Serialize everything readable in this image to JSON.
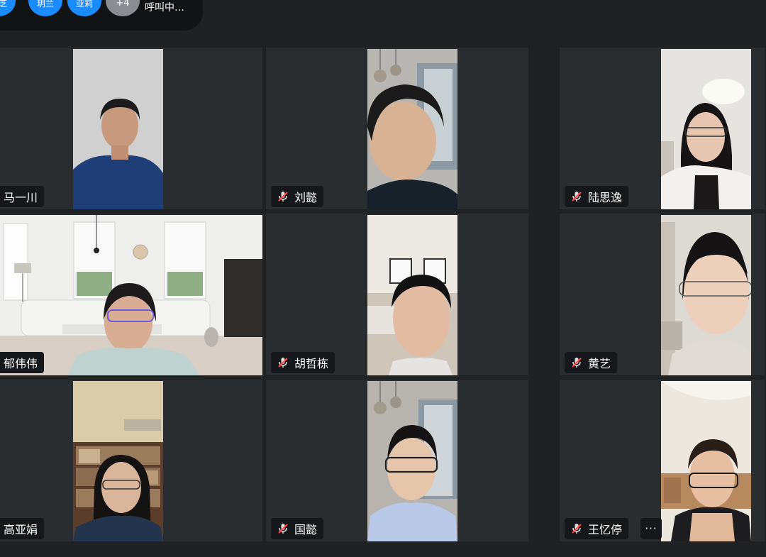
{
  "calling_bar": {
    "avatars": [
      "芳芝",
      "玥兰",
      "亚莉"
    ],
    "more_count": "+4",
    "status": "呼叫中…"
  },
  "participants": [
    {
      "name": "马一川",
      "muted": false
    },
    {
      "name": "刘懿",
      "muted": true
    },
    {
      "name": "陆思逸",
      "muted": true
    },
    {
      "name": "郁伟伟",
      "muted": false
    },
    {
      "name": "胡哲栋",
      "muted": true
    },
    {
      "name": "黄艺",
      "muted": true
    },
    {
      "name": "高亚娟",
      "muted": false
    },
    {
      "name": "国懿",
      "muted": true
    },
    {
      "name": "王忆停",
      "muted": true
    }
  ],
  "more_options": "···",
  "colors": {
    "accent": "#1a8cff",
    "muted_icon": "#ff4d4f",
    "tile_bg": "#2a2d2f"
  }
}
